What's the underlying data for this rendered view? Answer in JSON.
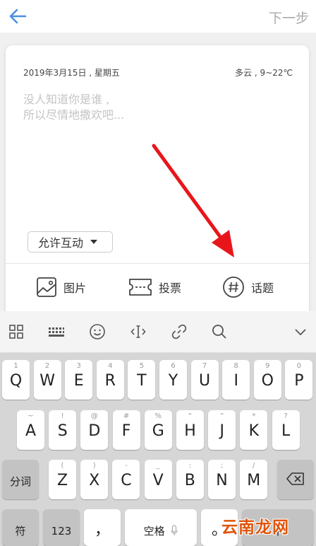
{
  "header": {
    "next_label": "下一步"
  },
  "post": {
    "date": "2019年3月15日 , 星期五",
    "weather": "多云 , 9~22℃",
    "placeholder_line1": "没人知道你是谁 ,",
    "placeholder_line2": "所以尽情地撒欢吧...",
    "permission_label": "允许互动"
  },
  "options": {
    "image_label": "图片",
    "vote_label": "投票",
    "topic_label": "话题"
  },
  "keyboard": {
    "row1": [
      {
        "main": "Q",
        "sub": "1"
      },
      {
        "main": "W",
        "sub": "2"
      },
      {
        "main": "E",
        "sub": "3"
      },
      {
        "main": "R",
        "sub": "4"
      },
      {
        "main": "T",
        "sub": "5"
      },
      {
        "main": "Y",
        "sub": "6"
      },
      {
        "main": "U",
        "sub": "7"
      },
      {
        "main": "I",
        "sub": "8"
      },
      {
        "main": "O",
        "sub": "9"
      },
      {
        "main": "P",
        "sub": "0"
      }
    ],
    "row2": [
      {
        "main": "A",
        "sub": "~"
      },
      {
        "main": "S",
        "sub": "!"
      },
      {
        "main": "D",
        "sub": "@"
      },
      {
        "main": "F",
        "sub": "#"
      },
      {
        "main": "G",
        "sub": "%"
      },
      {
        "main": "H",
        "sub": "“"
      },
      {
        "main": "J",
        "sub": "”"
      },
      {
        "main": "K",
        "sub": "*"
      },
      {
        "main": "L",
        "sub": "?"
      }
    ],
    "row3": [
      {
        "main": "Z",
        "sub": "("
      },
      {
        "main": "X",
        "sub": ")"
      },
      {
        "main": "C",
        "sub": "-"
      },
      {
        "main": "V",
        "sub": "_"
      },
      {
        "main": "B",
        "sub": ":"
      },
      {
        "main": "N",
        "sub": ";"
      },
      {
        "main": "M",
        "sub": "/"
      }
    ],
    "segment_label": "分词",
    "symbol_label": "符",
    "numeric_label": "123",
    "comma_label": "，",
    "space_label": "空格",
    "period_label": "。",
    "lang_label": "中"
  },
  "watermark": "云南龙网",
  "colors": {
    "accent": "#4a90e2",
    "arrow": "#e8161b"
  }
}
